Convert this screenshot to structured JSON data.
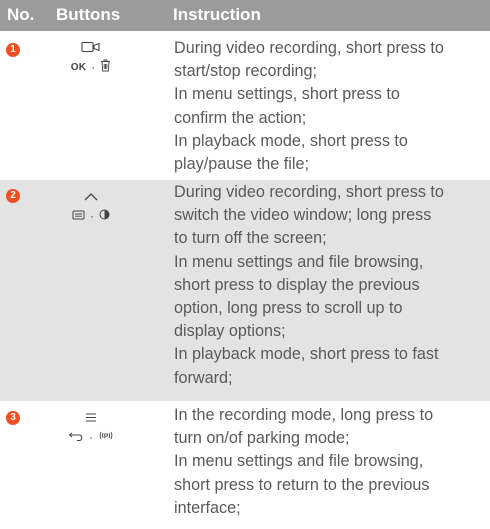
{
  "header": {
    "no": "No.",
    "buttons": "Buttons",
    "instruction": "Instruction"
  },
  "rows": [
    {
      "number": "1",
      "icon_top": "video-record-icon",
      "icon_bottom": [
        "OK",
        "trash-icon"
      ],
      "lines": [
        "During video recording, short press to",
        "start/stop recording;",
        "In menu settings, short press to",
        "confirm the action;",
        "In playback mode, short press to",
        "play/pause the file;"
      ]
    },
    {
      "number": "2",
      "icon_top": "chevron-up-icon",
      "icon_bottom": [
        "screen-window-icon",
        "contrast-icon"
      ],
      "lines": [
        "During video recording, short press to",
        "switch the video window; long press",
        "to turn off the screen;",
        "In menu settings and file browsing,",
        "short press to display the previous",
        "option, long press to scroll up to",
        "display options;",
        "In playback mode, short press to fast",
        "forward;"
      ]
    },
    {
      "number": "3",
      "icon_top": "menu-icon",
      "icon_bottom": [
        "back-arrow-icon",
        "parking-mode-icon"
      ],
      "lines": [
        "In the recording mode, long press to",
        "turn on/of parking mode;",
        "In menu settings and file browsing,",
        "short press to return to the previous",
        "interface;"
      ]
    }
  ],
  "colors": {
    "header_bg": "#9b9b9b",
    "badge": "#f04e23",
    "shaded_row": "#e3e3e3"
  }
}
